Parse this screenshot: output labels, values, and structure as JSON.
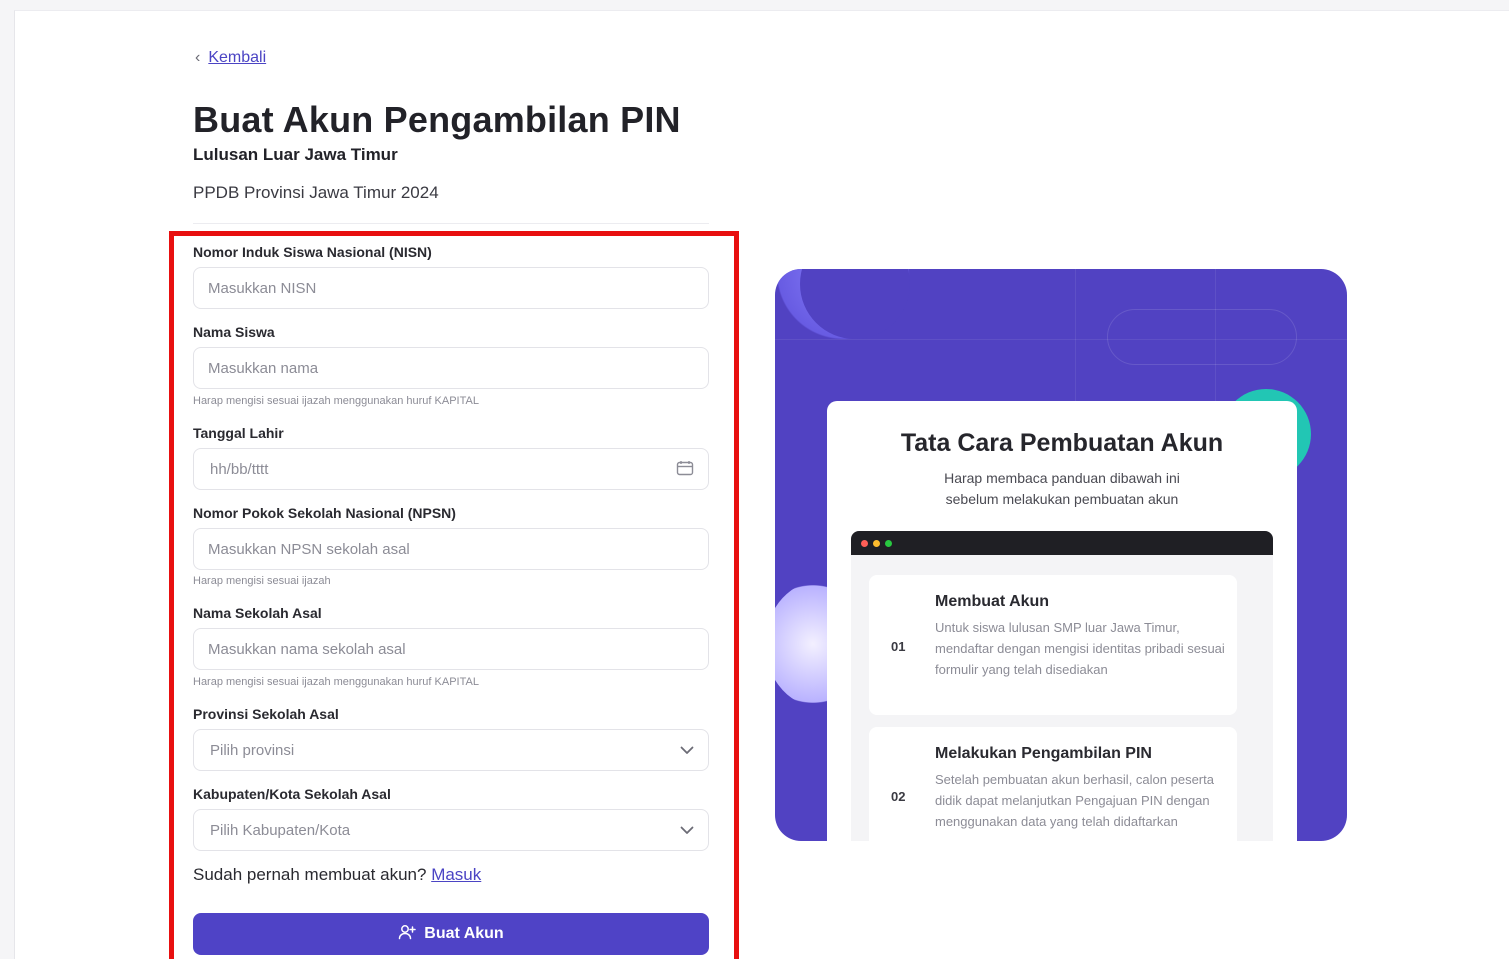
{
  "nav": {
    "back_label": "Kembali"
  },
  "header": {
    "title": "Buat Akun Pengambilan PIN",
    "subtitle": "Lulusan Luar Jawa Timur",
    "context": "PPDB Provinsi Jawa Timur 2024"
  },
  "form": {
    "nisn": {
      "label": "Nomor Induk Siswa Nasional (NISN)",
      "placeholder": "Masukkan NISN",
      "value": ""
    },
    "nama": {
      "label": "Nama Siswa",
      "placeholder": "Masukkan nama",
      "value": "",
      "hint": "Harap mengisi sesuai ijazah menggunakan huruf KAPITAL"
    },
    "tanggal_lahir": {
      "label": "Tanggal Lahir",
      "placeholder": "hh/bb/tttt",
      "value": ""
    },
    "npsn": {
      "label": "Nomor Pokok Sekolah Nasional (NPSN)",
      "placeholder": "Masukkan NPSN sekolah asal",
      "value": "",
      "hint": "Harap mengisi sesuai ijazah"
    },
    "sekolah": {
      "label": "Nama Sekolah Asal",
      "placeholder": "Masukkan nama sekolah asal",
      "value": "",
      "hint": "Harap mengisi sesuai ijazah menggunakan huruf KAPITAL"
    },
    "provinsi": {
      "label": "Provinsi Sekolah Asal",
      "selected": "Pilih provinsi"
    },
    "kabupaten": {
      "label": "Kabupaten/Kota Sekolah Asal",
      "selected": "Pilih Kabupaten/Kota"
    },
    "login_prompt": "Sudah pernah membuat akun?",
    "login_link": "Masuk",
    "submit_label": "Buat Akun"
  },
  "guide": {
    "title": "Tata Cara Pembuatan Akun",
    "desc_line1": "Harap membaca panduan dibawah ini",
    "desc_line2": "sebelum melakukan pembuatan akun",
    "steps": [
      {
        "num": "01",
        "title": "Membuat Akun",
        "desc": "Untuk siswa lulusan SMP luar Jawa Timur, mendaftar dengan mengisi identitas pribadi sesuai formulir yang telah disediakan"
      },
      {
        "num": "02",
        "title": "Melakukan Pengambilan PIN",
        "desc": "Setelah pembuatan akun berhasil, calon peserta didik dapat melanjutkan Pengajuan PIN dengan menggunakan data yang telah didaftarkan"
      }
    ]
  },
  "colors": {
    "primary": "#4f43c6",
    "link": "#4b44c4",
    "highlight": "#e80f0f",
    "panel": "#5142c2",
    "accent_teal": "#22c6b4"
  },
  "icons": {
    "back": "chevron-left-icon",
    "date": "calendar-icon",
    "select": "chevron-down-icon",
    "submit": "user-add-icon"
  }
}
